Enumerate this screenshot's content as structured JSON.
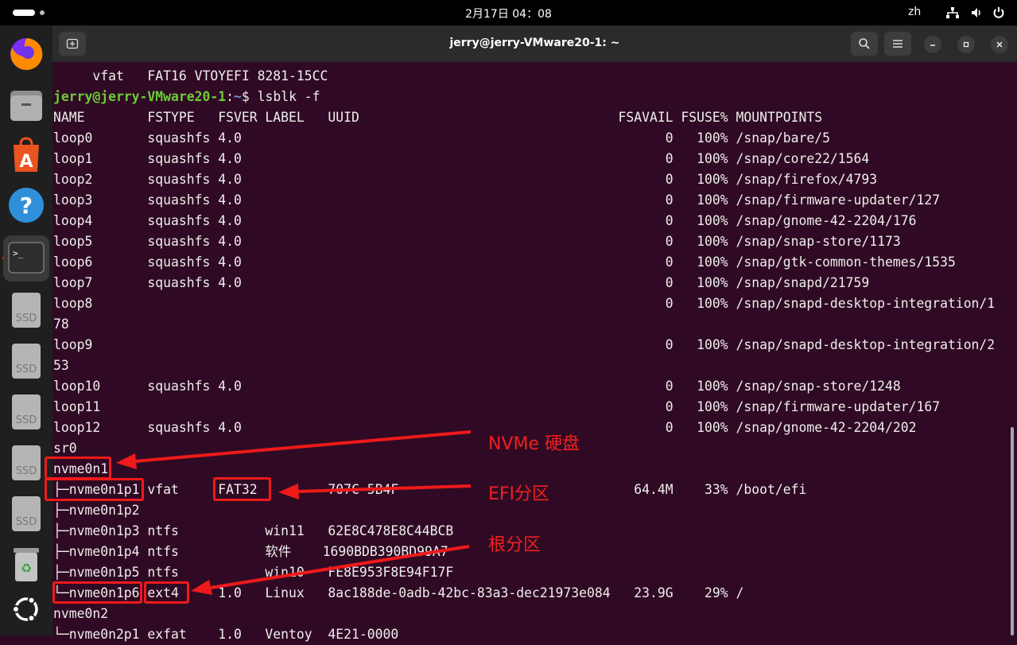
{
  "topbar": {
    "clock": "2月17日  04：08",
    "lang": "zh"
  },
  "dock": {
    "items": [
      {
        "name": "firefox-icon"
      },
      {
        "name": "files-icon"
      },
      {
        "name": "app-center-icon"
      },
      {
        "name": "help-icon"
      },
      {
        "name": "terminal-icon"
      },
      {
        "name": "ssd-drive-icon",
        "label": "SSD"
      },
      {
        "name": "ssd-drive-icon",
        "label": "SSD"
      },
      {
        "name": "ssd-drive-icon",
        "label": "SSD"
      },
      {
        "name": "ssd-drive-icon",
        "label": "SSD"
      },
      {
        "name": "ssd-drive-icon",
        "label": "SSD"
      },
      {
        "name": "trash-icon"
      },
      {
        "name": "show-apps-icon"
      }
    ]
  },
  "window": {
    "title": "jerry@jerry-VMware20-1: ~"
  },
  "terminal": {
    "prompt_user": "jerry@jerry-VMware20-1",
    "prompt_path": "~",
    "prompt_sep": ":",
    "prompt_symbol": "$",
    "command": " lsblk -f",
    "lines": [
      "     vfat   FAT16 VTOYEFI 8281-15CC",
      "__PROMPT__",
      "NAME        FSTYPE   FSVER LABEL   UUID                                 FSAVAIL FSUSE% MOUNTPOINTS",
      "loop0       squashfs 4.0                                                      0   100% /snap/bare/5",
      "loop1       squashfs 4.0                                                      0   100% /snap/core22/1564",
      "loop2       squashfs 4.0                                                      0   100% /snap/firefox/4793",
      "loop3       squashfs 4.0                                                      0   100% /snap/firmware-updater/127",
      "loop4       squashfs 4.0                                                      0   100% /snap/gnome-42-2204/176",
      "loop5       squashfs 4.0                                                      0   100% /snap/snap-store/1173",
      "loop6       squashfs 4.0                                                      0   100% /snap/gtk-common-themes/1535",
      "loop7       squashfs 4.0                                                      0   100% /snap/snapd/21759",
      "loop8                                                                         0   100% /snap/snapd-desktop-integration/1",
      "78",
      "loop9                                                                         0   100% /snap/snapd-desktop-integration/2",
      "53",
      "loop10      squashfs 4.0                                                      0   100% /snap/snap-store/1248",
      "loop11                                                                        0   100% /snap/firmware-updater/167",
      "loop12      squashfs 4.0                                                      0   100% /snap/gnome-42-2204/202",
      "sr0",
      "nvme0n1",
      "├─nvme0n1p1 vfat     FAT32         707C-5B4F                              64.4M    33% /boot/efi",
      "├─nvme0n1p2",
      "├─nvme0n1p3 ntfs           win11   62E8C478E8C44BCB",
      "├─nvme0n1p4 ntfs           软件    1690BDB390BD99A7",
      "├─nvme0n1p5 ntfs           win10   FE8E953F8E94F17F",
      "└─nvme0n1p6 ext4     1.0   Linux   8ac188de-0adb-42bc-83a3-dec21973e084   23.9G    29% /",
      "nvme0n2",
      "└─nvme0n2p1 exfat    1.0   Ventoy  4E21-0000"
    ]
  },
  "annotations": {
    "nvme_label": "NVMe 硬盘",
    "efi_label": "EFI分区",
    "root_label": "根分区",
    "color": "#ef1a1a"
  },
  "colors": {
    "terminal_bg": "#300a24",
    "prompt_user": "#6ccc38",
    "prompt_path": "#6f9fd8"
  }
}
